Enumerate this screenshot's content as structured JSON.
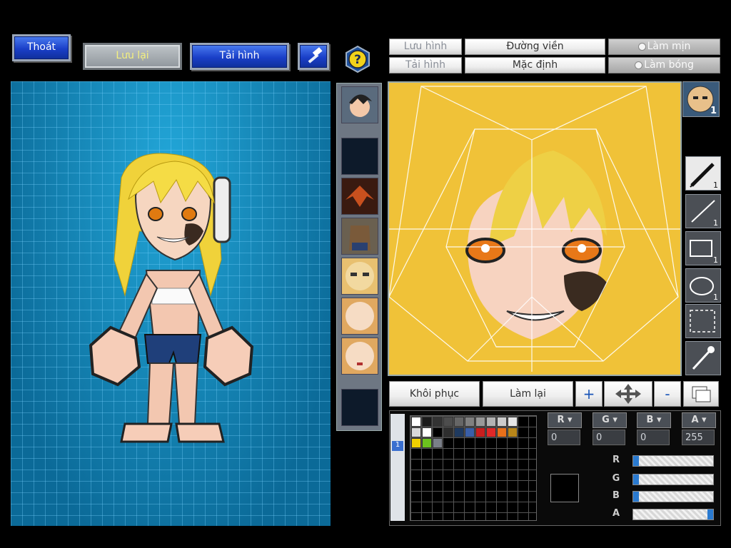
{
  "toolbar": {
    "exit_label": "Thoát",
    "save_label": "Lưu lại",
    "load_label": "Tải hình",
    "hammer_icon": "hammer-icon",
    "help_icon": "question-mark-icon"
  },
  "face_editor": {
    "save_image_label": "Lưu hình",
    "load_image_label": "Tải hình",
    "outline_label": "Đường viền",
    "default_label": "Mặc định",
    "smooth_label": "Làm mịn",
    "shade_label": "Làm bóng"
  },
  "tools": {
    "preset_badge": "1",
    "pen_count": "1",
    "line_count": "1",
    "rect_count": "1",
    "ellipse_count": "1"
  },
  "actions": {
    "restore_label": "Khôi phục",
    "redo_label": "Làm lại",
    "plus_label": "+",
    "minus_label": "-"
  },
  "color": {
    "channels": [
      "R",
      "G",
      "B",
      "A"
    ],
    "values": [
      "0",
      "0",
      "0",
      "255"
    ],
    "slider_levels": [
      0,
      0,
      0,
      1.0
    ],
    "palette_row1": [
      "#ffffff",
      "#1a1a1a",
      "#333333",
      "#4d4d4d",
      "#666666",
      "#808080",
      "#999999",
      "#b3b3b3",
      "#cccccc",
      "#e6e6e6"
    ],
    "palette_row2": [
      "#d9d9d9",
      "#ffffff",
      "#000000",
      "#2e2e2e",
      "#1f3a5f",
      "#3a5fa8",
      "#c81e1e",
      "#e02828",
      "#e8701a",
      "#b8861a"
    ],
    "palette_row3": [
      "#f0d000",
      "#6cc21e",
      "#7a7f88"
    ]
  },
  "colors": {
    "accent_blue": "#1a3fc8",
    "canvas_blue": "#0f86b8",
    "face_bg": "#f0c238"
  }
}
